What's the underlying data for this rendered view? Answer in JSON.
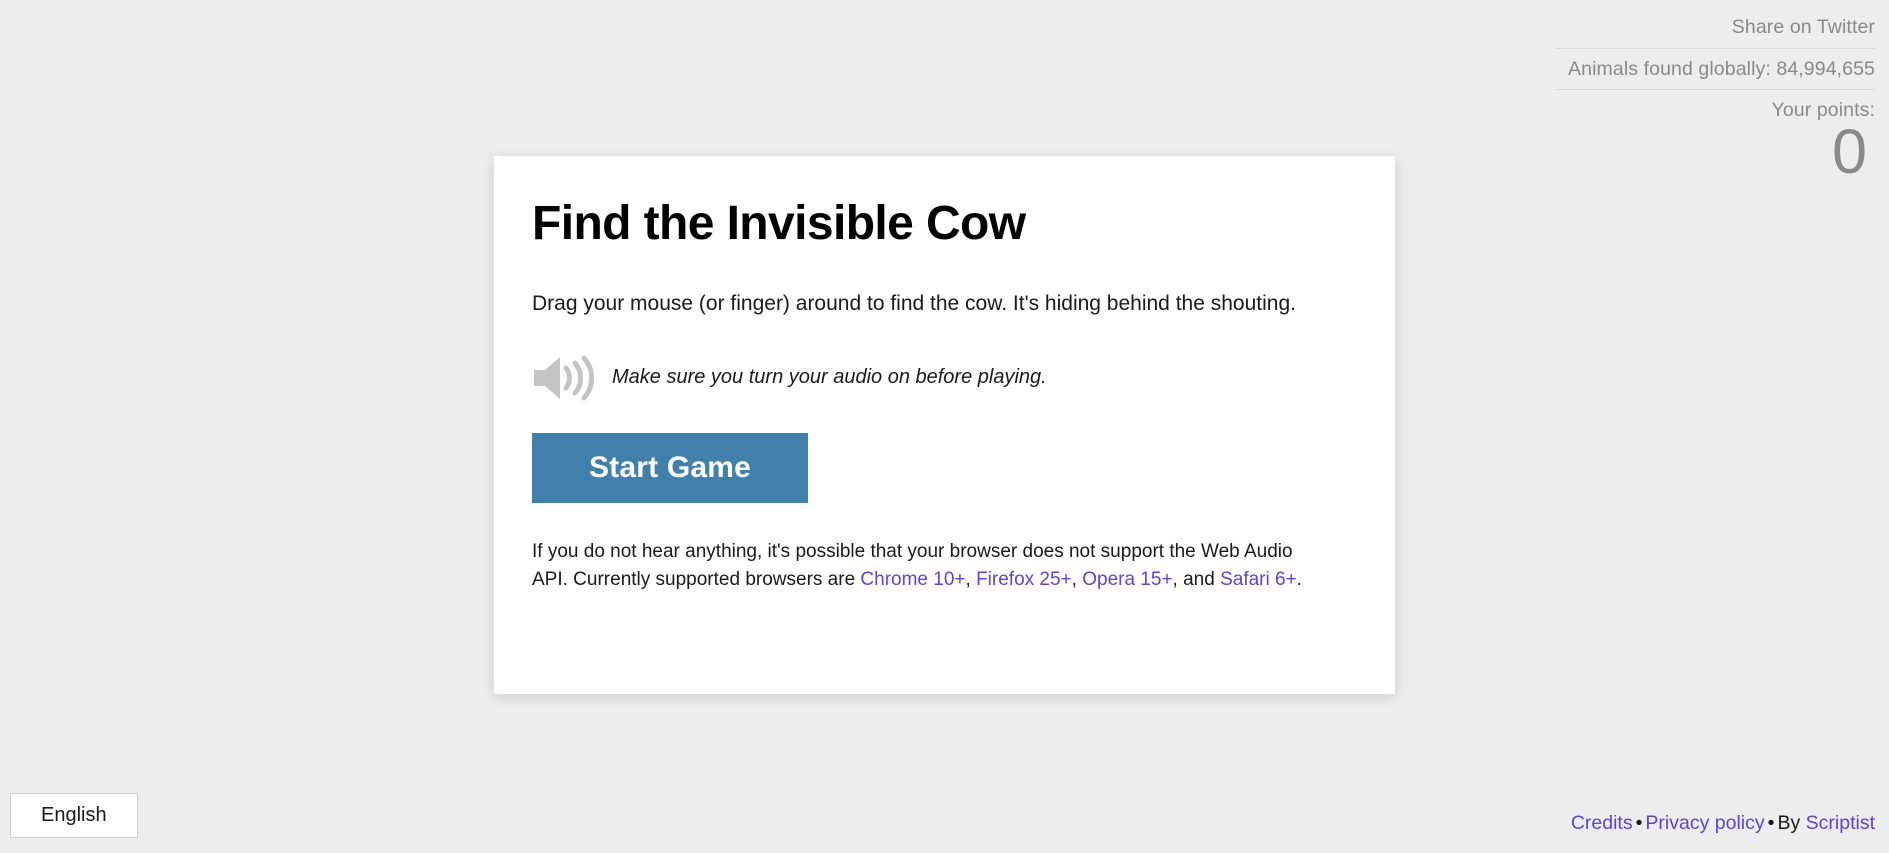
{
  "stats": {
    "twitter_label": "Share on Twitter",
    "animals_found_label": "Animals found globally: 84,994,655",
    "points_label": "Your points:",
    "points_value": "0"
  },
  "card": {
    "title": "Find the Invisible Cow",
    "instructions": "Drag your mouse (or finger) around to find the cow. It's hiding behind the shouting.",
    "audio_notice": "Make sure you turn your audio on before playing.",
    "start_button": "Start Game",
    "support": {
      "text_before": "If you do not hear anything, it's possible that your browser does not support the Web Audio API. Currently supported browsers are ",
      "browser_1": "Chrome 10+",
      "sep_1": ", ",
      "browser_2": "Firefox 25+",
      "sep_2": ", ",
      "browser_3": "Opera 15+",
      "sep_3": ", and ",
      "browser_4": "Safari 6+",
      "text_after": "."
    }
  },
  "language": {
    "selected": "English",
    "options": [
      "English"
    ]
  },
  "footer": {
    "credits": "Credits",
    "bullet_1": "•",
    "privacy": "Privacy policy",
    "bullet_2": "•",
    "by_text": "By",
    "author": "Scriptist"
  },
  "colors": {
    "background": "#ededed",
    "card": "#ffffff",
    "button": "#4180ab",
    "link": "#5b45d6",
    "muted_text": "#8a8a8a"
  }
}
